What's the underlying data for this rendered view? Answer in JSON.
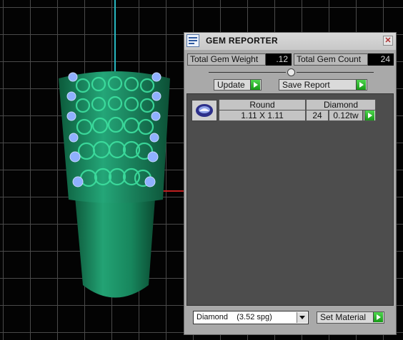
{
  "window": {
    "title": "GEM REPORTER",
    "close_glyph": "✕"
  },
  "summary": {
    "weight_label": "Total Gem Weight",
    "weight_value": ".12",
    "count_label": "Total Gem Count",
    "count_value": "24"
  },
  "actions": {
    "update_label": "Update",
    "save_report_label": "Save Report"
  },
  "gem_row": {
    "shape_header": "Round",
    "material_header": "Diamond",
    "size": "1.11 X 1.11",
    "count": "24",
    "weight": "0.12tw",
    "thumbnail_icon": "round-gem-icon"
  },
  "footer": {
    "material_selected": "Diamond    (3.52 spg)",
    "set_material_label": "Set Material"
  },
  "colors": {
    "accent_green": "#2fbf2f",
    "model_green": "#1a8a5c",
    "gem_blue": "#8fb0ff",
    "axis_cyan": "#27b7c0",
    "axis_red": "#c02020"
  }
}
